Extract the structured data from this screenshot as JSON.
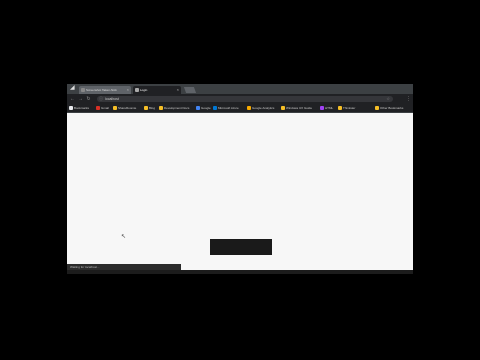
{
  "browser": {
    "tabs": [
      {
        "title": "Screenshot Taken-Nick",
        "active": false
      },
      {
        "title": "Login",
        "active": true
      }
    ],
    "address": {
      "url": "localhost"
    },
    "bookmarks": [
      {
        "label": "Bookmarks",
        "color": "#e8eaed"
      },
      {
        "label": "Gmail",
        "color": "#d93025"
      },
      {
        "label": "ShareRoomie",
        "color": "#f6bf26"
      },
      {
        "label": "Blog",
        "color": "#f6bf26"
      },
      {
        "label": "Development Docs",
        "color": "#f6bf26"
      },
      {
        "label": "Google",
        "color": "#4285f4"
      },
      {
        "label": "Microsoft Azure",
        "color": "#0078d4"
      },
      {
        "label": "Google Analytics",
        "color": "#f9ab00"
      },
      {
        "label": "Windows UX Guide",
        "color": "#f6bf26"
      },
      {
        "label": "HTML",
        "color": "#a142f4"
      },
      {
        "label": "Thinkster",
        "color": "#f6bf26"
      },
      {
        "label": "Other Bookmarks",
        "color": "#f6bf26"
      }
    ]
  },
  "page": {
    "status_text": "Waiting for localhost..."
  },
  "colors": {
    "frame": "#202124",
    "page_bg": "#f7f7f7",
    "dark_box": "#1a1a1a"
  }
}
